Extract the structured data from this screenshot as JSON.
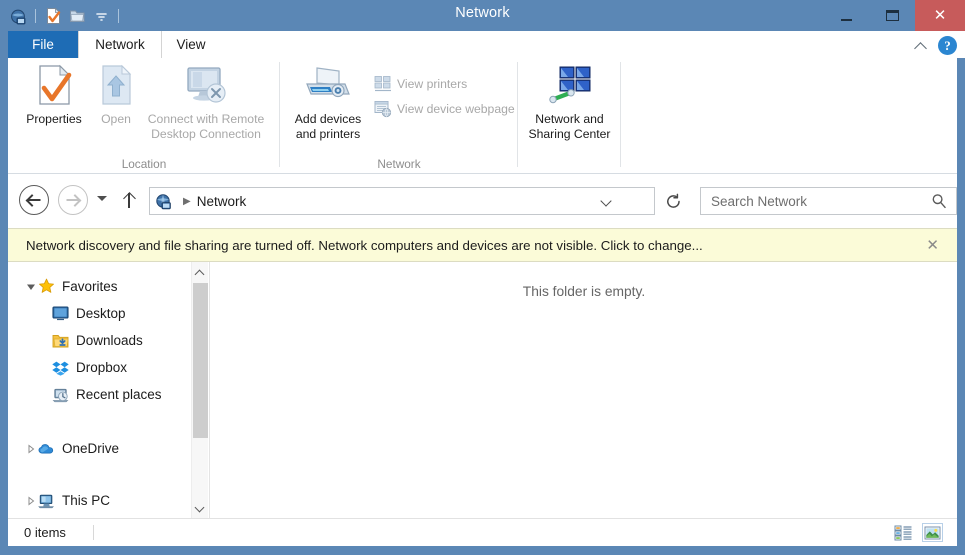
{
  "window": {
    "title": "Network",
    "controls": {
      "minimize": "Minimize",
      "maximize": "Restore",
      "close": "Close"
    },
    "quick_access": [
      {
        "name": "network-icon",
        "label": "Network"
      },
      {
        "name": "properties-icon",
        "label": "Properties"
      },
      {
        "name": "new-folder-icon",
        "label": "New folder"
      },
      {
        "name": "customize-dropdown-icon",
        "label": "Customize Quick Access Toolbar"
      }
    ]
  },
  "ribbon": {
    "tabs": [
      {
        "label": "File",
        "selected": false,
        "style": "file"
      },
      {
        "label": "Network",
        "selected": true,
        "style": "normal"
      },
      {
        "label": "View",
        "selected": false,
        "style": "normal"
      }
    ],
    "collapse_icon": "chevron-up-icon",
    "help_label": "?",
    "groups": [
      {
        "label": "Location",
        "buttons": [
          {
            "label": "Properties",
            "enabled": true,
            "icon": "properties-icon"
          },
          {
            "label": "Open",
            "enabled": false,
            "icon": "open-icon"
          },
          {
            "label": "Connect with Remote\nDesktop Connection",
            "line1": "Connect with Remote",
            "line2": "Desktop Connection",
            "enabled": false,
            "icon": "remote-desktop-icon"
          }
        ]
      },
      {
        "label": "Network",
        "buttons": [
          {
            "label": "Add devices\nand printers",
            "line1": "Add devices",
            "line2": "and printers",
            "enabled": true,
            "icon": "printer-icon"
          }
        ],
        "small_buttons": [
          {
            "label": "View printers",
            "enabled": false,
            "icon": "view-printers-icon"
          },
          {
            "label": "View device webpage",
            "enabled": false,
            "icon": "view-webpage-icon"
          }
        ]
      },
      {
        "label": "",
        "buttons": [
          {
            "label": "Network and\nSharing Center",
            "line1": "Network and",
            "line2": "Sharing Center",
            "enabled": true,
            "icon": "network-sharing-icon"
          }
        ]
      }
    ]
  },
  "navbar": {
    "back": {
      "label": "Back",
      "enabled": true,
      "icon": "arrow-left-icon"
    },
    "forward": {
      "label": "Forward",
      "enabled": false,
      "icon": "arrow-right-icon"
    },
    "recent": {
      "label": "Recent locations",
      "icon": "chevron-down-icon"
    },
    "up": {
      "label": "Up to Desktop",
      "icon": "arrow-up-icon"
    },
    "breadcrumb": {
      "icon": "network-globe-icon",
      "separator": "▶",
      "path": "Network"
    },
    "address_dropdown_icon": "chevron-down-icon",
    "refresh": {
      "label": "Refresh",
      "icon": "refresh-icon"
    },
    "search": {
      "placeholder": "Search Network",
      "value": "",
      "icon": "search-icon"
    }
  },
  "notification": {
    "text": "Network discovery and file sharing are turned off. Network computers and devices are not visible. Click to change...",
    "close_label": "✕"
  },
  "navpane": {
    "items": [
      {
        "label": "Favorites",
        "icon": "star-icon",
        "indent": 0,
        "expander": "expanded"
      },
      {
        "label": "Desktop",
        "icon": "desktop-icon",
        "indent": 1,
        "expander": "none"
      },
      {
        "label": "Downloads",
        "icon": "downloads-icon",
        "indent": 1,
        "expander": "none"
      },
      {
        "label": "Dropbox",
        "icon": "dropbox-icon",
        "indent": 1,
        "expander": "none"
      },
      {
        "label": "Recent places",
        "icon": "recent-places-icon",
        "indent": 1,
        "expander": "none"
      },
      {
        "label": "OneDrive",
        "icon": "onedrive-cloud-icon",
        "indent": 0,
        "expander": "collapsed"
      },
      {
        "label": "This PC",
        "icon": "this-pc-icon",
        "indent": 0,
        "expander": "collapsed"
      }
    ],
    "scrollbar": {
      "up_icon": "chevron-up-icon",
      "down_icon": "chevron-down-icon"
    }
  },
  "content": {
    "empty_message": "This folder is empty."
  },
  "statusbar": {
    "item_count": "0 items",
    "views": [
      {
        "name": "details-view-button",
        "label": "Details view",
        "active": false
      },
      {
        "name": "large-icons-view-button",
        "label": "Large icons view",
        "active": true
      }
    ]
  },
  "colors": {
    "window_frame": "#5b87b5",
    "file_tab": "#1e6cb5",
    "close_button": "#c75b5b",
    "notification_bg": "#fbfbd8",
    "help_button": "#2b86d1"
  }
}
